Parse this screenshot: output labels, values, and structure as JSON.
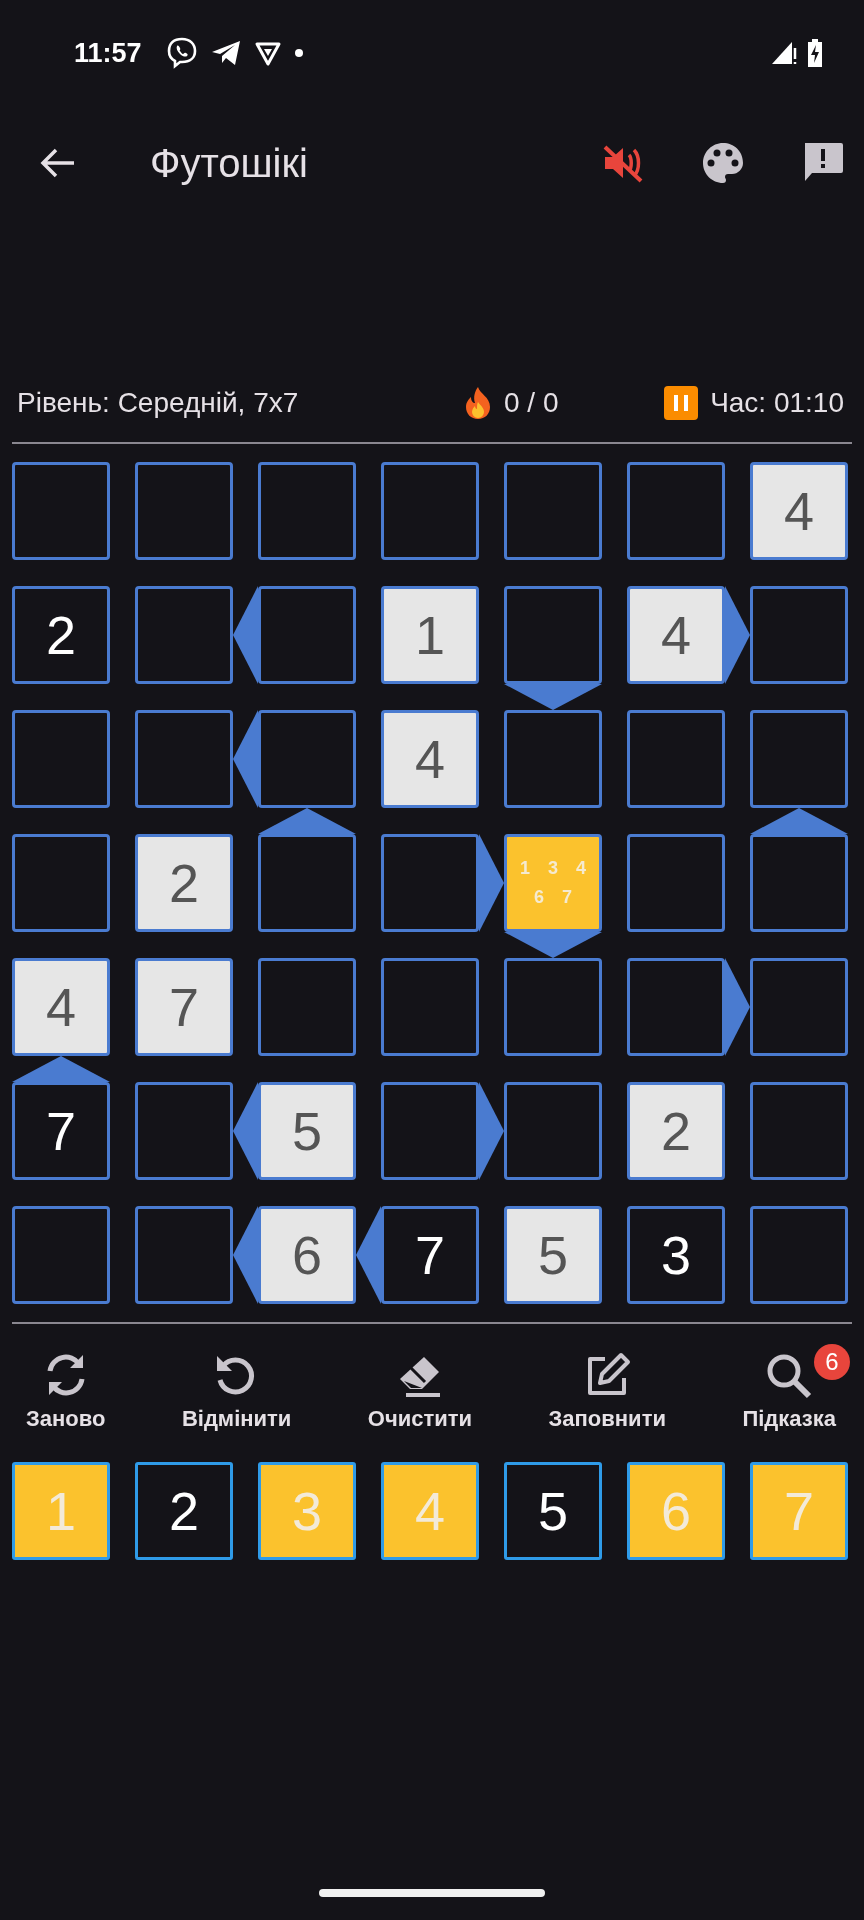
{
  "status_bar": {
    "time": "11:57"
  },
  "app_bar": {
    "title": "Футошікі",
    "sound_muted": true
  },
  "info": {
    "level": "Рівень: Середній, 7x7",
    "streak": "0 / 0",
    "timer": "Час: 01:10"
  },
  "board": {
    "rows": [
      [
        {
          "given": false,
          "selected": false
        },
        {
          "given": false,
          "selected": false
        },
        {
          "given": false,
          "selected": false
        },
        {
          "given": false,
          "selected": false
        },
        {
          "given": false,
          "selected": false
        },
        {
          "given": false,
          "selected": false
        },
        {
          "value": "4",
          "given": true,
          "selected": false
        }
      ],
      [
        {
          "value": "2",
          "given": false,
          "selected": false
        },
        {
          "given": false,
          "selected": false,
          "signs": [
            {
              "kind": "left"
            }
          ]
        },
        {
          "given": false,
          "selected": false
        },
        {
          "value": "1",
          "given": true,
          "selected": false
        },
        {
          "given": false,
          "selected": false,
          "signs": [
            {
              "kind": "down"
            }
          ]
        },
        {
          "value": "4",
          "given": true,
          "selected": false,
          "signs": [
            {
              "kind": "right"
            }
          ]
        },
        {
          "given": false,
          "selected": false
        }
      ],
      [
        {
          "given": false,
          "selected": false
        },
        {
          "given": false,
          "selected": false,
          "signs": [
            {
              "kind": "left"
            }
          ]
        },
        {
          "given": false,
          "selected": false,
          "signs": [
            {
              "kind": "up"
            }
          ]
        },
        {
          "value": "4",
          "given": true,
          "selected": false
        },
        {
          "given": false,
          "selected": false
        },
        {
          "given": false,
          "selected": false
        },
        {
          "given": false,
          "selected": false,
          "signs": [
            {
              "kind": "up"
            }
          ]
        }
      ],
      [
        {
          "given": false,
          "selected": false
        },
        {
          "value": "2",
          "given": true,
          "selected": false
        },
        {
          "given": false,
          "selected": false
        },
        {
          "given": false,
          "selected": false,
          "signs": [
            {
              "kind": "right"
            }
          ]
        },
        {
          "given": false,
          "selected": true,
          "notes": [
            "1",
            "3",
            "4",
            "6",
            "7"
          ],
          "signs": [
            {
              "kind": "down"
            }
          ]
        },
        {
          "given": false,
          "selected": false
        },
        {
          "given": false,
          "selected": false
        }
      ],
      [
        {
          "value": "4",
          "given": true,
          "selected": false,
          "signs": [
            {
              "kind": "up"
            }
          ]
        },
        {
          "value": "7",
          "given": true,
          "selected": false
        },
        {
          "given": false,
          "selected": false
        },
        {
          "given": false,
          "selected": false
        },
        {
          "given": false,
          "selected": false
        },
        {
          "given": false,
          "selected": false,
          "signs": [
            {
              "kind": "right"
            }
          ]
        },
        {
          "given": false,
          "selected": false
        }
      ],
      [
        {
          "value": "7",
          "given": false,
          "selected": false
        },
        {
          "given": false,
          "selected": false,
          "signs": [
            {
              "kind": "left"
            }
          ]
        },
        {
          "value": "5",
          "given": true,
          "selected": false
        },
        {
          "given": false,
          "selected": false,
          "signs": [
            {
              "kind": "right"
            }
          ]
        },
        {
          "given": false,
          "selected": false
        },
        {
          "value": "2",
          "given": true,
          "selected": false
        },
        {
          "given": false,
          "selected": false
        }
      ],
      [
        {
          "given": false,
          "selected": false
        },
        {
          "given": false,
          "selected": false,
          "signs": [
            {
              "kind": "left"
            }
          ]
        },
        {
          "value": "6",
          "given": true,
          "selected": false,
          "signs": [
            {
              "kind": "left"
            }
          ]
        },
        {
          "value": "7",
          "given": false,
          "selected": false
        },
        {
          "value": "5",
          "given": true,
          "selected": false
        },
        {
          "value": "3",
          "given": false,
          "selected": false
        },
        {
          "given": false,
          "selected": false
        }
      ]
    ]
  },
  "tools": [
    {
      "kind": "restart",
      "label": "Заново"
    },
    {
      "kind": "undo",
      "label": "Відмінити"
    },
    {
      "kind": "erase",
      "label": "Очистити"
    },
    {
      "kind": "fill",
      "label": "Заповнити"
    },
    {
      "kind": "hint",
      "label": "Підказка",
      "badge": "6"
    }
  ],
  "number_pad": [
    {
      "label": "1",
      "highlighted": true
    },
    {
      "label": "2",
      "highlighted": false
    },
    {
      "label": "3",
      "highlighted": true
    },
    {
      "label": "4",
      "highlighted": true
    },
    {
      "label": "5",
      "highlighted": false
    },
    {
      "label": "6",
      "highlighted": true
    },
    {
      "label": "7",
      "highlighted": true
    }
  ]
}
